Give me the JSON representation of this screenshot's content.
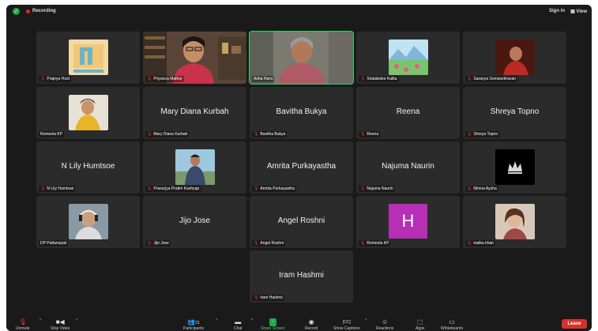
{
  "topbar": {
    "recording_label": "Recording",
    "sign_in": "Sign in",
    "view": "View"
  },
  "tiles": [
    {
      "name": "Prajnya Host",
      "big": ""
    },
    {
      "name": "Priyanca Mathur",
      "big": ""
    },
    {
      "name": "Asha Hans",
      "big": ""
    },
    {
      "name": "Shatabdee Kalita",
      "big": ""
    },
    {
      "name": "Saranya Somasekharan",
      "big": ""
    },
    {
      "name": "Romeela KP",
      "big": ""
    },
    {
      "name": "Mary Diana Kurbah",
      "big": "Mary Diana Kurbah"
    },
    {
      "name": "Bavitha Bukya",
      "big": "Bavitha Bukya"
    },
    {
      "name": "Reena",
      "big": "Reena"
    },
    {
      "name": "Shreya Topno",
      "big": "Shreya Topno"
    },
    {
      "name": "N Lily Humtsoe",
      "big": "N Lily Humtsoe"
    },
    {
      "name": "Prasurjya Pratim Kashyap",
      "big": ""
    },
    {
      "name": "Amrita Purkayastha",
      "big": "Amrita Purkayastha"
    },
    {
      "name": "Najuma Naurin",
      "big": "Najuma Naurin"
    },
    {
      "name": "Nimna Aysha",
      "big": ""
    },
    {
      "name": "DP Pattanayak",
      "big": ""
    },
    {
      "name": "Jijo Jose",
      "big": "Jijo Jose"
    },
    {
      "name": "Angel Roshni",
      "big": "Angel Roshni"
    },
    {
      "name": "Romeela KP",
      "big": "H"
    },
    {
      "name": "malka khan",
      "big": ""
    },
    {
      "name": "Iram Hashmi",
      "big": "Iram Hashmi"
    }
  ],
  "toolbar": {
    "unmute": "Unmute",
    "stop_video": "Stop Video",
    "participants": "Participants",
    "participants_count": "21",
    "chat": "Chat",
    "share_screen": "Share Screen",
    "record": "Record",
    "show_captions": "Show Captions",
    "reactions": "Reactions",
    "apps": "Apps",
    "whiteboards": "Whiteboards",
    "leave": "Leave"
  },
  "colors": {
    "accent_green": "#2bd36a",
    "leave_red": "#d8312c",
    "avatar_purple": "#b62fb5"
  }
}
